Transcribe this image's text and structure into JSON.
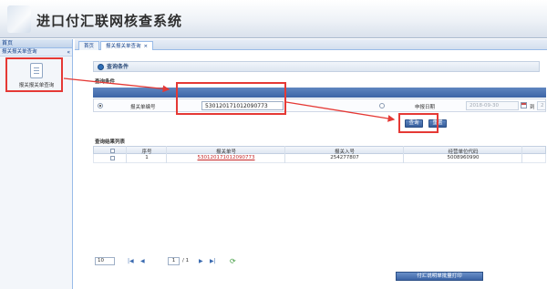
{
  "app": {
    "title": "进口付汇联网核查系统"
  },
  "sidebar": {
    "header": "首页",
    "section": "报关报关单查询",
    "collapse": "«",
    "module_label": "报关报关单查询"
  },
  "tabs": [
    {
      "label": "首页",
      "active": false
    },
    {
      "label": "报关报关单查询",
      "close": "×",
      "active": true
    }
  ],
  "panel": {
    "title": "查询条件"
  },
  "conditions": {
    "label": "查询条件",
    "declaration_label": "报关单编号",
    "declaration_value": "530120171012090773",
    "declare_date_label": "申报日期",
    "date_from": "2018-09-30",
    "to_label": "到",
    "date_to": "2"
  },
  "buttons": {
    "query": "查询",
    "reset": "重置",
    "bottom": "付汇说明单批量打印"
  },
  "results": {
    "label": "查询结果列表",
    "columns": [
      "序号",
      "报关单号",
      "经营单位代码",
      "经营单位代码"
    ],
    "header_cols": [
      "",
      "序号",
      "报关单号",
      "报关单号",
      "经营单位代码"
    ],
    "rows": [
      {
        "index": "1",
        "decl_no": "530120171012090773",
        "entry_no": "254277807",
        "company_code": "5008960990"
      }
    ]
  },
  "grid_header": {
    "c1": "序号",
    "c2": "报关单号",
    "c3": "报关入号",
    "c4": "经营单位代码"
  },
  "pager": {
    "page_size": "10",
    "first": "|◀",
    "prev": "◀",
    "page": "1",
    "total": "/ 1",
    "next": "▶",
    "last": "▶|",
    "refresh": "⟳"
  },
  "colors": {
    "accent": "#3c64a6",
    "highlight": "#e53935",
    "link": "#c62828"
  }
}
